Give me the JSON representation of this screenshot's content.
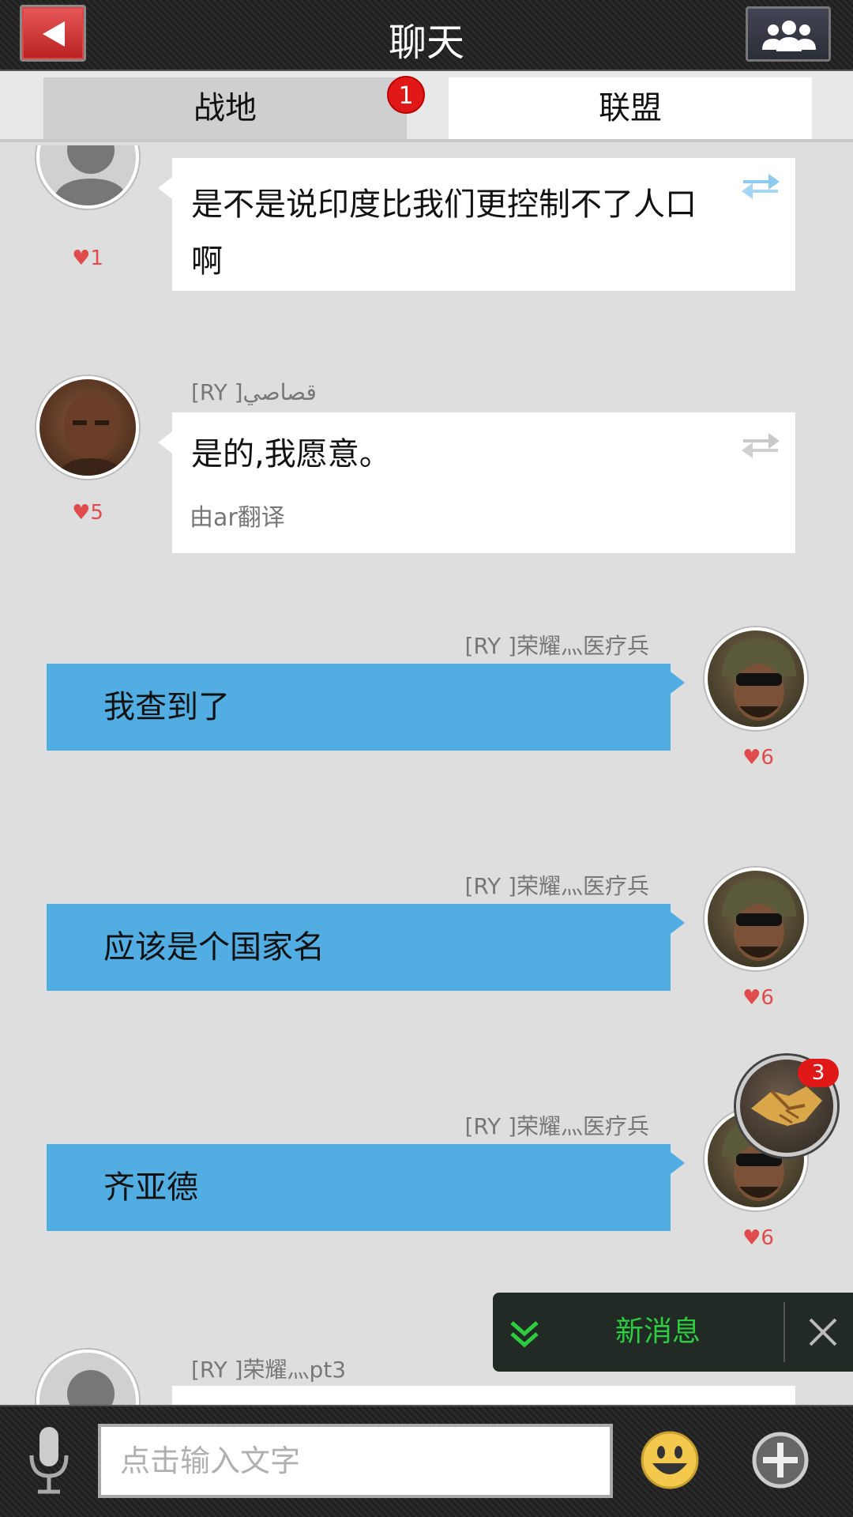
{
  "header": {
    "title": "聊天"
  },
  "tabs": [
    {
      "label": "战地",
      "badge": "1"
    },
    {
      "label": "联盟"
    }
  ],
  "messages": [
    {
      "text_line1": "是不是说印度比我们更控制不了人口",
      "text_line2": "啊",
      "likes": "1"
    },
    {
      "username": "[RY ]قصاصي",
      "text": "是的,我愿意。",
      "translated_by": "由ar翻译",
      "likes": "5"
    },
    {
      "username": "[RY ]荣耀灬医疗兵",
      "text": "我查到了",
      "likes": "6"
    },
    {
      "username": "[RY ]荣耀灬医疗兵",
      "text": "应该是个国家名",
      "likes": "6"
    },
    {
      "username": "[RY ]荣耀灬医疗兵",
      "text": "齐亚德",
      "likes": "6"
    },
    {
      "username": "[RY ]荣耀灬pt3"
    }
  ],
  "alliance_help": {
    "badge": "3"
  },
  "toast": {
    "label": "新消息"
  },
  "input": {
    "placeholder": "点击输入文字"
  },
  "colors": {
    "bubble_out": "#52ade3",
    "likes": "#e04b4b",
    "toast_text": "#2ecc40"
  }
}
